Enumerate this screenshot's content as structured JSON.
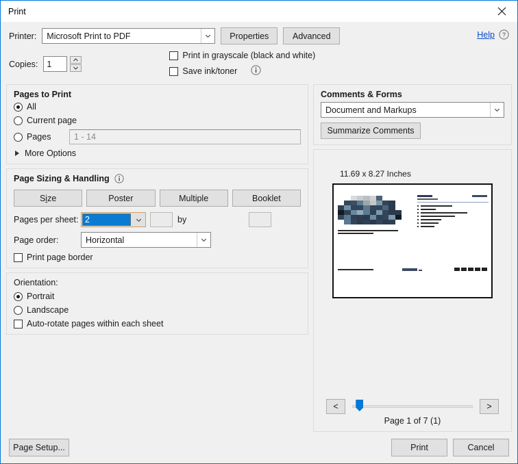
{
  "window": {
    "title": "Print",
    "close_icon": "close-icon",
    "accent_color": "#0078d7"
  },
  "printer": {
    "label": "Printer:",
    "value": "Microsoft Print to PDF",
    "properties_label": "Properties",
    "advanced_label": "Advanced",
    "help_label": "Help",
    "help_icon": "question-circle-icon"
  },
  "copies": {
    "label": "Copies:",
    "value": "1",
    "up_icon": "spinner-up-icon",
    "down_icon": "spinner-down-icon"
  },
  "print_options": {
    "grayscale_label": "Print in grayscale (black and white)",
    "grayscale_checked": false,
    "save_ink_label": "Save ink/toner",
    "save_ink_checked": false,
    "save_ink_info_icon": "info-circle-icon"
  },
  "pages_to_print": {
    "title": "Pages to Print",
    "selected": "All",
    "options": [
      {
        "label": "All",
        "checked": true
      },
      {
        "label": "Current page",
        "checked": false
      },
      {
        "label": "Pages",
        "checked": false
      }
    ],
    "pages_placeholder": "1 - 14",
    "pages_value": "",
    "more_options_label": "More Options",
    "more_options_icon": "triangle-right-icon"
  },
  "page_sizing": {
    "title": "Page Sizing & Handling",
    "info_icon": "info-circle-icon",
    "buttons": [
      {
        "label": "Size",
        "accel": "i"
      },
      {
        "label": "Poster",
        "accel": ""
      },
      {
        "label": "Multiple",
        "accel": ""
      },
      {
        "label": "Booklet",
        "accel": ""
      }
    ],
    "pages_per_sheet_label": "Pages per sheet:",
    "pages_per_sheet_value": "2",
    "custom_cols": "",
    "custom_rows": "",
    "by_label": "by",
    "page_order_label": "Page order:",
    "page_order_value": "Horizontal",
    "print_border_label": "Print page border",
    "print_border_checked": false,
    "selection_color": "#0a7bd2"
  },
  "orientation": {
    "label": "Orientation:",
    "options": [
      {
        "label": "Portrait",
        "checked": true
      },
      {
        "label": "Landscape",
        "checked": false
      }
    ],
    "auto_rotate_label": "Auto-rotate pages within each sheet",
    "auto_rotate_checked": false
  },
  "comments_forms": {
    "title": "Comments & Forms",
    "value": "Document and Markups",
    "summarize_label": "Summarize Comments"
  },
  "preview": {
    "dimensions": "11.69 x 8.27 Inches",
    "page_label": "Page 1 of 7 (1)",
    "prev_label": "<",
    "next_label": ">",
    "slider_position_percent": 3,
    "slider_color": "#0078d7",
    "mosaic_colors": [
      "#ffffff",
      "#ffffff",
      "#d8dadb",
      "#c8ccce",
      "#b9bfc3",
      "#cfd1d2",
      "#4e6275",
      "#ffffff",
      "#ffffff",
      "#ffffff",
      "#ffffff",
      "#35475a",
      "#3c4f63",
      "#5d7b92",
      "#9fa7ab",
      "#c3c7c9",
      "#7e97ab",
      "#32445a",
      "#2b3a4c",
      "#ffffff",
      "#2e3f52",
      "#6f8fa6",
      "#33455a",
      "#2f4considered",
      "#5a7a92",
      "#33455a",
      "#324559",
      "#4d6578",
      "#2a3a4d",
      "#ffffff",
      "#111a22",
      "#2f4154",
      "#6a88a0",
      "#8fa9bd",
      "#5c7a91",
      "#2e4053",
      "#7d97ab",
      "#33455a",
      "#2b3a4d",
      "#2b3a4d",
      "#33455a",
      "#5a7a92",
      "#2e4053",
      "#2c3d50",
      "#2a3a4d",
      "#6d8ba3",
      "#2e4053",
      "#33455a",
      "#7d97ab",
      "#111a22",
      "#ffffff",
      "#5a7a92",
      "#33455a",
      "#2b3a4d",
      "#2e4053",
      "#2a3a4d",
      "#33455a",
      "#2b3a4d",
      "#2e4053",
      "#ffffff"
    ],
    "right_slide_bullets": [
      46,
      22,
      68,
      50,
      30,
      26,
      20
    ]
  },
  "footer": {
    "page_setup_label": "Page Setup...",
    "print_label": "Print",
    "cancel_label": "Cancel"
  }
}
